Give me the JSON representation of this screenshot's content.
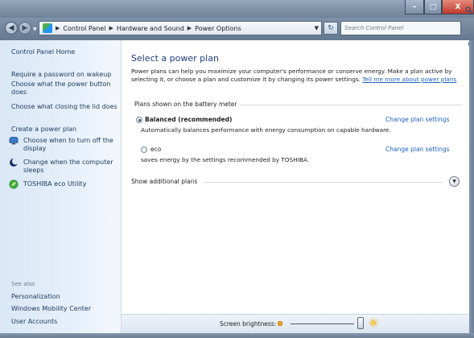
{
  "window": {
    "min_glyph": "–",
    "max_glyph": "□",
    "close_glyph": "X"
  },
  "address_bar": {
    "back_glyph": "◀",
    "forward_glyph": "▶",
    "recent_glyph": "▼",
    "sep_glyph": "▶",
    "crumbs": [
      "Control Panel",
      "Hardware and Sound",
      "Power Options"
    ],
    "refresh_glyph": "↻",
    "search_placeholder": "Search Control Panel"
  },
  "sidebar": {
    "home": "Control Panel Home",
    "links": [
      "Require a password on wakeup",
      "Choose what the power button does",
      "Choose what closing the lid does",
      "Create a power plan"
    ],
    "icon_links": [
      {
        "label": "Choose when to turn off the display",
        "icon": "monitor-icon"
      },
      {
        "label": "Change when the computer sleeps",
        "icon": "moon-icon"
      },
      {
        "label": "TOSHIBA eco Utility",
        "icon": "eco-leaf-icon"
      }
    ],
    "see_also_title": "See also",
    "see_also": [
      "Personalization",
      "Windows Mobility Center",
      "User Accounts"
    ]
  },
  "main": {
    "title": "Select a power plan",
    "intro": "Power plans can help you maximize your computer's performance or conserve energy. Make a plan active by selecting it, or choose a plan and customize it by changing its power settings.",
    "intro_link": "Tell me more about power plans",
    "group_title": "Plans shown on the battery meter",
    "plans": [
      {
        "name": "Balanced (recommended)",
        "selected": true,
        "description": "Automatically balances performance with energy consumption on capable hardware.",
        "link": "Change plan settings"
      },
      {
        "name": "eco",
        "selected": false,
        "description": "saves energy by the settings recommended by TOSHIBA.",
        "link": "Change plan settings"
      }
    ],
    "show_additional": "Show additional plans",
    "expand_glyph": "▼"
  },
  "bottom": {
    "brightness_label": "Screen brightness:",
    "brightness_level": 1.0
  },
  "colors": {
    "link": "#1f5fbf",
    "heading": "#1f3c83",
    "sidebar_bg": "#dce9f7"
  }
}
